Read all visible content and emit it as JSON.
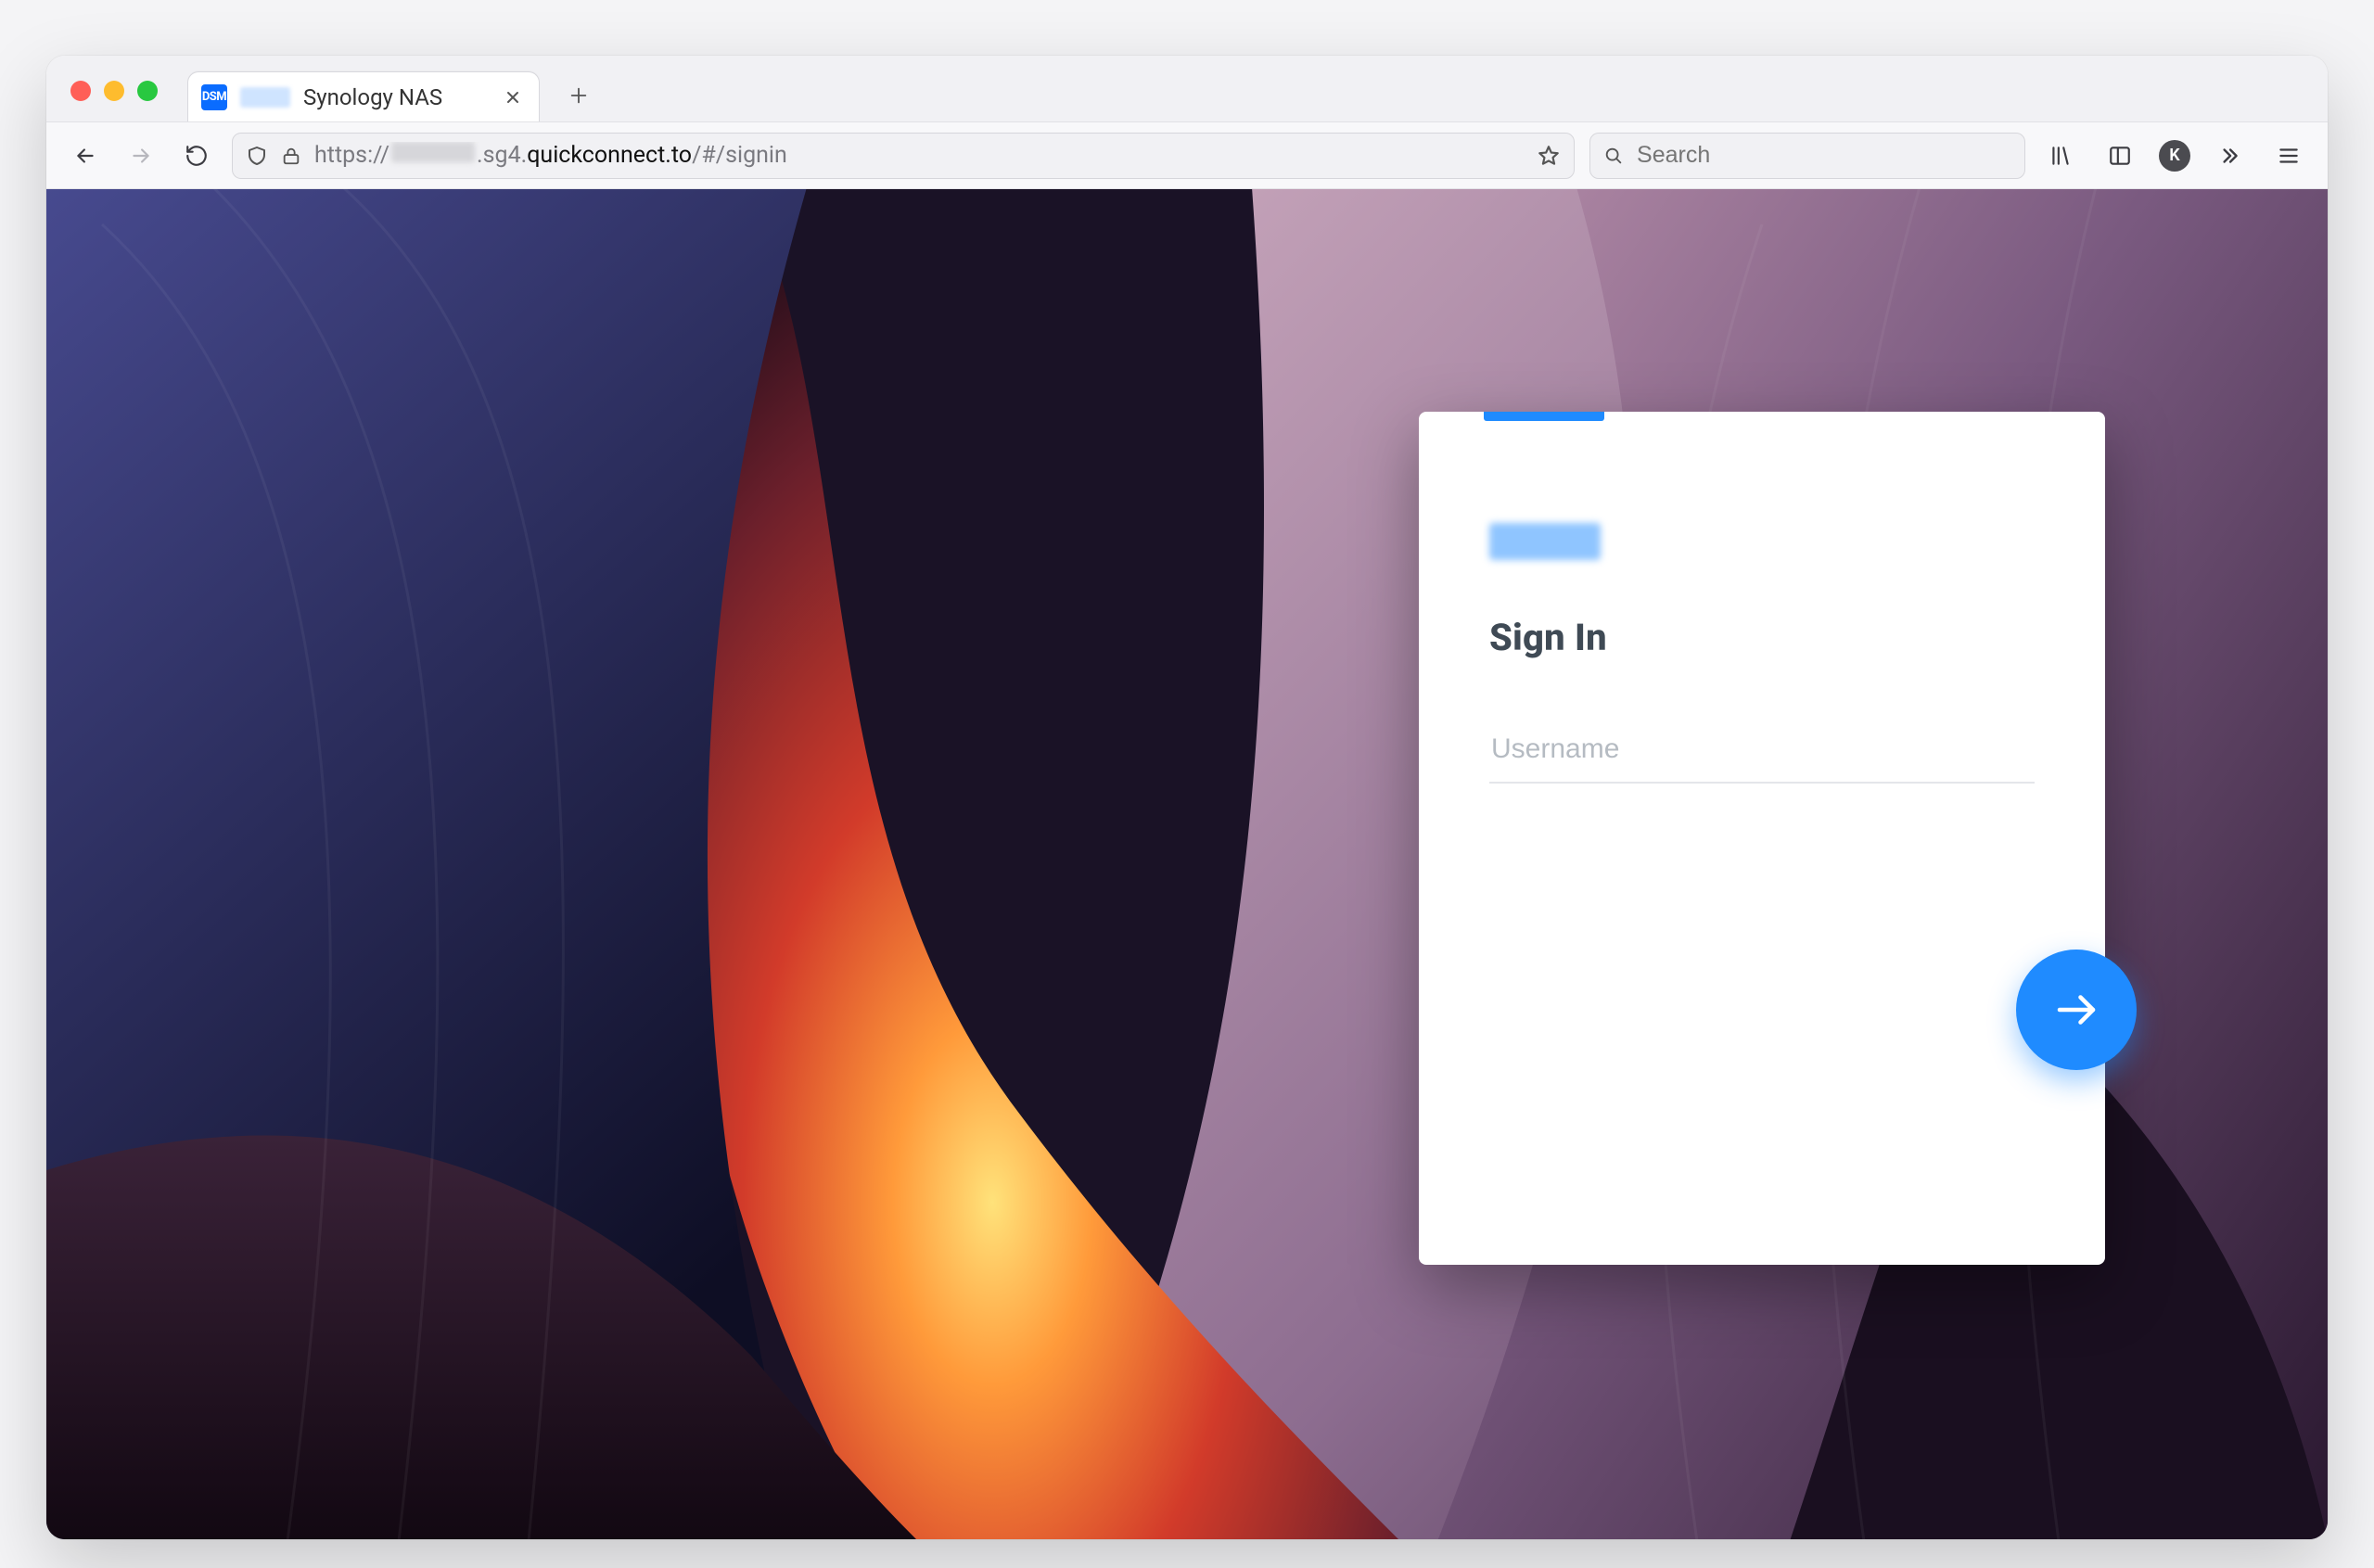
{
  "browser": {
    "tab": {
      "favicon_label": "DSM",
      "title": "Synology NAS"
    },
    "url": {
      "scheme": "https://",
      "host_suffix": ".sg4.",
      "domain": "quickconnect.to",
      "path": "/#/signin"
    },
    "search_placeholder": "Search",
    "profile_initial": "K"
  },
  "login": {
    "title": "Sign In",
    "username_placeholder": "Username",
    "username_value": "",
    "accent_color": "#1f8bff"
  }
}
